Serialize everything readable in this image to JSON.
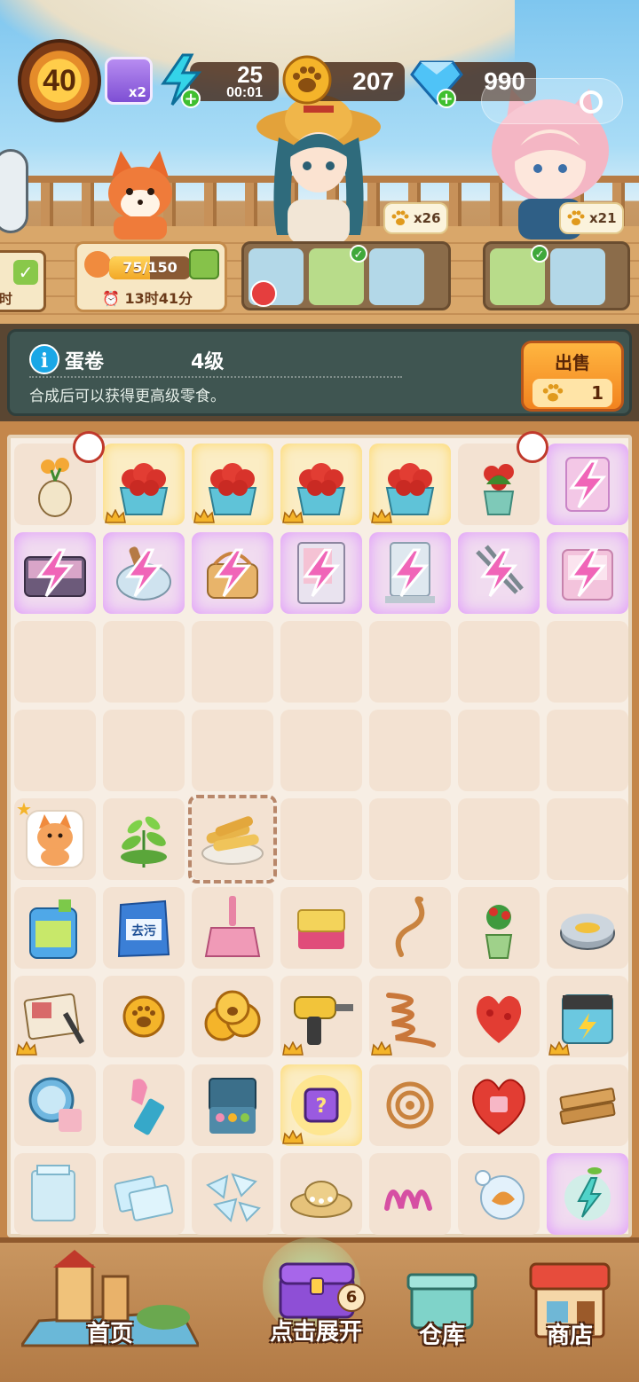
{
  "hud": {
    "level": "40",
    "energy_multiplier": "x2",
    "energy_value": "25",
    "energy_timer": "00:01",
    "paw_coins": "207",
    "diamonds": "990",
    "icons": [
      "level-star-icon",
      "energy-bolt-icon",
      "paw-coin-icon",
      "diamond-icon",
      "menu-ring-icon"
    ]
  },
  "scene": {
    "order_left_tag": "时",
    "fox_progress_text": "75/150",
    "fox_progress_fraction": 0.5,
    "fox_timer": "13时41分",
    "customer1_paw_reward": "x26",
    "customer2_paw_reward": "x21"
  },
  "info": {
    "item_name": "蛋卷",
    "item_level": "4级",
    "description": "合成后可以获得更高级零食。",
    "sell_label": "出售",
    "sell_price": "1"
  },
  "board": {
    "rows": [
      [
        "vase-flowers",
        "rose-bouquet",
        "rose-bouquet",
        "rose-bouquet",
        "rose-bouquet",
        "potted-roses",
        "locked-pink-item"
      ],
      [
        "locked-makeup-case",
        "locked-bowl",
        "locked-basket",
        "locked-vending-machine",
        "locked-display-case",
        "locked-tongs",
        "locked-pink-box"
      ],
      [
        "empty",
        "empty",
        "empty",
        "empty",
        "empty",
        "empty",
        "empty"
      ],
      [
        "empty",
        "empty",
        "empty",
        "empty",
        "empty",
        "empty",
        "empty"
      ],
      [
        "fox-sticker",
        "green-plant",
        "egg-rolls",
        "empty",
        "empty",
        "empty",
        "empty"
      ],
      [
        "detergent-jug",
        "detergent-bag",
        "dustpan",
        "sponge",
        "rope",
        "potted-plant",
        "round-tin"
      ],
      [
        "recipe-book",
        "paw-coin-single",
        "paw-coins-pile",
        "power-drill",
        "coiled-rope",
        "rose-petals",
        "battery"
      ],
      [
        "compact-mirror",
        "lipstick",
        "eyeshadow-palette",
        "mystery-box",
        "wire-coil",
        "rose-heart",
        "wooden-planks"
      ],
      [
        "glass-box",
        "glass-panes",
        "broken-glass",
        "straw-hat",
        "spring-coil",
        "glass-orb",
        "energy-sprout"
      ]
    ],
    "detergent_bag_text": "去污"
  },
  "nav": {
    "home_label": "首页",
    "expand_label": "点击展开",
    "expand_badge": "6",
    "warehouse_label": "仓库",
    "shop_label": "商店"
  },
  "colors": {
    "board_bg": "#f7eee4",
    "cell_bg": "#f3e2d2",
    "info_bg": "#3f5551",
    "sell_orange": "#f2831f",
    "locked_glow": "#d678ff"
  }
}
